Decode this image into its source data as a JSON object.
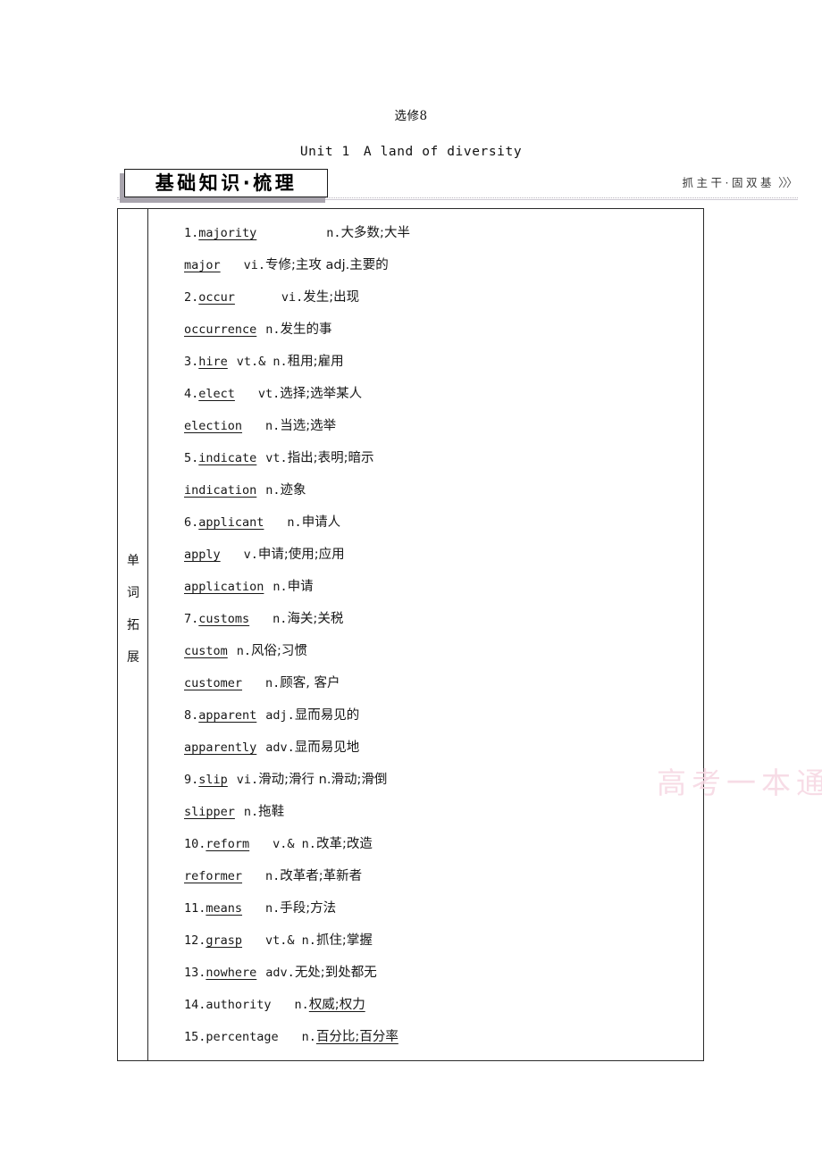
{
  "page": {
    "book_title": "选修8",
    "unit_title": "Unit 1　A land of diversity",
    "watermark": "高考一本通"
  },
  "section_header": {
    "badge_label": "基础知识·梳理",
    "right_label": "抓主干·固双基",
    "chevrons": "〉〉〉"
  },
  "table": {
    "row_label": "单词拓展",
    "row_label_chars": [
      "单",
      "词",
      "拓",
      "展"
    ],
    "rows": [
      {
        "num": "1.",
        "word": "majority",
        "word_underlined": true,
        "gap": "gap-xl",
        "pos": "n.",
        "meaning": "大多数;大半",
        "meaning_underlined": false
      },
      {
        "num": "",
        "word": "major",
        "word_underlined": true,
        "gap": "gap-m",
        "pos": "vi.",
        "meaning": "专修;主攻 adj.主要的",
        "meaning_underlined": false
      },
      {
        "num": "2.",
        "word": "occur",
        "word_underlined": true,
        "gap": "gap-l",
        "pos": "vi.",
        "meaning": "发生;出现",
        "meaning_underlined": false
      },
      {
        "num": "",
        "word": "occurrence",
        "word_underlined": true,
        "gap": "gap-s",
        "pos": "n.",
        "meaning": "发生的事",
        "meaning_underlined": false
      },
      {
        "num": "3.",
        "word": "hire",
        "word_underlined": true,
        "gap": "gap-s",
        "pos": "vt.& n.",
        "meaning": "租用;雇用",
        "meaning_underlined": false
      },
      {
        "num": "4.",
        "word": "elect",
        "word_underlined": true,
        "gap": "gap-m",
        "pos": "vt.",
        "meaning": "选择;选举某人",
        "meaning_underlined": false
      },
      {
        "num": "",
        "word": "election",
        "word_underlined": true,
        "gap": "gap-m",
        "pos": "n.",
        "meaning": "当选;选举",
        "meaning_underlined": false
      },
      {
        "num": "5.",
        "word": "indicate",
        "word_underlined": true,
        "gap": "gap-s",
        "pos": "vt.",
        "meaning": "指出;表明;暗示",
        "meaning_underlined": false
      },
      {
        "num": "",
        "word": "indication",
        "word_underlined": true,
        "gap": "gap-s",
        "pos": "n.",
        "meaning": "迹象",
        "meaning_underlined": false
      },
      {
        "num": "6.",
        "word": "applicant",
        "word_underlined": true,
        "gap": "gap-m",
        "pos": "n.",
        "meaning": "申请人",
        "meaning_underlined": false
      },
      {
        "num": "",
        "word": "apply",
        "word_underlined": true,
        "gap": "gap-m",
        "pos": "v.",
        "meaning": "申请;使用;应用",
        "meaning_underlined": false
      },
      {
        "num": "",
        "word": "application",
        "word_underlined": true,
        "gap": "gap-s",
        "pos": "n.",
        "meaning": "申请",
        "meaning_underlined": false
      },
      {
        "num": "7.",
        "word": "customs",
        "word_underlined": true,
        "gap": "gap-m",
        "pos": "n.",
        "meaning": "海关;关税",
        "meaning_underlined": false
      },
      {
        "num": "",
        "word": "custom",
        "word_underlined": true,
        "gap": "gap-s",
        "pos": "n.",
        "meaning": "风俗;习惯",
        "meaning_underlined": false
      },
      {
        "num": "",
        "word": "customer",
        "word_underlined": true,
        "gap": "gap-m",
        "pos": "n.",
        "meaning": "顾客, 客户",
        "meaning_underlined": false
      },
      {
        "num": "8.",
        "word": "apparent",
        "word_underlined": true,
        "gap": "gap-s",
        "pos": "adj.",
        "meaning": "显而易见的",
        "meaning_underlined": false
      },
      {
        "num": "",
        "word": "apparently",
        "word_underlined": true,
        "gap": "gap-s",
        "pos": "adv.",
        "meaning": "显而易见地",
        "meaning_underlined": false
      },
      {
        "num": "9.",
        "word": "slip",
        "word_underlined": true,
        "gap": "gap-s",
        "pos": "vi.",
        "meaning": "滑动;滑行 n.滑动;滑倒",
        "meaning_underlined": false
      },
      {
        "num": "",
        "word": "slipper",
        "word_underlined": true,
        "gap": "gap-s",
        "pos": "n.",
        "meaning": "拖鞋",
        "meaning_underlined": false
      },
      {
        "num": "10.",
        "word": "reform",
        "word_underlined": true,
        "gap": "gap-m",
        "pos": "v.& n.",
        "meaning": "改革;改造",
        "meaning_underlined": false
      },
      {
        "num": "",
        "word": "reformer",
        "word_underlined": true,
        "gap": "gap-m",
        "pos": "n.",
        "meaning": "改革者;革新者",
        "meaning_underlined": false
      },
      {
        "num": "11.",
        "word": "means",
        "word_underlined": true,
        "gap": "gap-m",
        "pos": "n.",
        "meaning": "手段;方法",
        "meaning_underlined": false
      },
      {
        "num": "12.",
        "word": "grasp",
        "word_underlined": true,
        "gap": "gap-m",
        "pos": "vt.& n.",
        "meaning": "抓住;掌握",
        "meaning_underlined": false
      },
      {
        "num": "13.",
        "word": "nowhere",
        "word_underlined": true,
        "gap": "gap-s",
        "pos": "adv.",
        "meaning": "无处;到处都无",
        "meaning_underlined": false
      },
      {
        "num": "14.",
        "word": "authority",
        "word_underlined": false,
        "gap": "gap-m",
        "pos": "n.",
        "meaning": "权威;权力",
        "meaning_underlined": true
      },
      {
        "num": "15.",
        "word": "percentage",
        "word_underlined": false,
        "gap": "gap-m",
        "pos": "n.",
        "meaning": "百分比;百分率",
        "meaning_underlined": true
      }
    ]
  }
}
